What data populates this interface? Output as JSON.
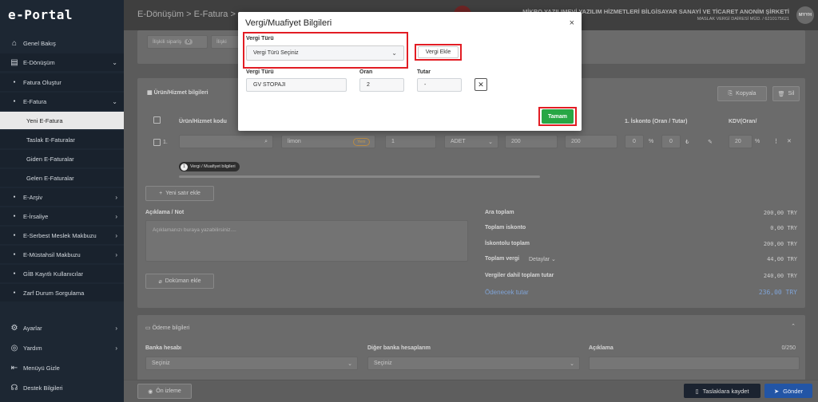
{
  "sidebar": {
    "logo": "e-Portal",
    "items": [
      {
        "label": "Genel Bakış"
      },
      {
        "label": "E-Dönüşüm"
      },
      {
        "label": "Fatura Oluştur"
      },
      {
        "label": "E-Fatura"
      },
      {
        "label": "Yeni E-Fatura"
      },
      {
        "label": "Taslak E-Faturalar"
      },
      {
        "label": "Giden E-Faturalar"
      },
      {
        "label": "Gelen E-Faturalar"
      },
      {
        "label": "E-Arşiv"
      },
      {
        "label": "E-İrsaliye"
      },
      {
        "label": "E-Serbest Meslek Makbuzu"
      },
      {
        "label": "E-Müstahsil Makbuzu"
      },
      {
        "label": "GİB Kayıtlı Kullanıcılar"
      },
      {
        "label": "Zarf Durum Sorgulama"
      },
      {
        "label": "Ayarlar"
      },
      {
        "label": "Yardım"
      },
      {
        "label": "Menüyü Gizle"
      },
      {
        "label": "Destek Bilgileri"
      }
    ]
  },
  "header": {
    "breadcrumb": "E-Dönüşüm > E-Fatura >",
    "company_name": "MİKRO YAZILIMEVİ YAZILIM HİZMETLERİ BİLGİSAYAR SANAYİ VE TİCARET ANONİM ŞİRKETİ",
    "company_sub": "MASLAK VERGİ DAİRESİ MÜD. / 6210175621",
    "avatar": "MYYH"
  },
  "tabs": {
    "related_orders": "İlişkili sipariş",
    "related_orders_count": "0",
    "related_other": "İlişki"
  },
  "products": {
    "title": "Ürün/Hizmet bilgileri",
    "copy": "Kopyala",
    "delete": "Sil",
    "col_product": "Ürün/Hizmet kodu",
    "col_discount": "1. İskonto (Oran / Tutar)",
    "col_kdv": "KDV(Oran/",
    "row": {
      "index": "1.",
      "name": "limon",
      "tag": "Yeni",
      "qty": "1",
      "unit": "ADET",
      "price": "200",
      "total": "200",
      "disc_rate": "0",
      "disc_amount": "0",
      "kdv": "20"
    },
    "tax_pill_count": "1",
    "tax_pill": "Vergi / Muafiyet bilgileri",
    "add_row": "Yeni satır ekle"
  },
  "notes": {
    "label": "Açıklama / Not",
    "placeholder": "Açıklamanızı buraya yazabilirsiniz....",
    "doc_button": "Doküman ekle"
  },
  "totals": [
    {
      "label": "Ara toplam",
      "value": "200,00 TRY"
    },
    {
      "label": "Toplam iskonto",
      "value": "0,00 TRY"
    },
    {
      "label": "İskontolu toplam",
      "value": "200,00 TRY"
    },
    {
      "label": "Toplam vergi",
      "extra": "Detaylar",
      "value": "44,00 TRY"
    },
    {
      "label": "Vergiler dahil toplam tutar",
      "value": "240,00 TRY"
    },
    {
      "label": "Ödenecek tutar",
      "value": "236,00 TRY"
    }
  ],
  "payment": {
    "title": "Ödeme bilgileri",
    "bank_label": "Banka hesabı",
    "bank_value": "Seçiniz",
    "other_label": "Diğer banka hesaplarım",
    "other_value": "Seçiniz",
    "desc_label": "Açıklama",
    "desc_count": "0/250"
  },
  "bottom": {
    "preview": "Ön izleme",
    "save_draft": "Taslaklara kaydet",
    "send": "Gönder"
  },
  "modal": {
    "title": "Vergi/Muafiyet Bilgileri",
    "tax_type_label": "Vergi Türü",
    "tax_type_select": "Vergi Türü Seçiniz",
    "add_tax": "Vergi Ekle",
    "col_type": "Vergi Türü",
    "col_rate": "Oran",
    "col_amount": "Tutar",
    "row_type": "GV STOPAJI",
    "row_rate": "2",
    "row_amount": "-",
    "ok": "Tamam"
  },
  "colors": {
    "highlight": "#e21d24",
    "ok": "#28a745",
    "sidebar": "#1d2733"
  }
}
